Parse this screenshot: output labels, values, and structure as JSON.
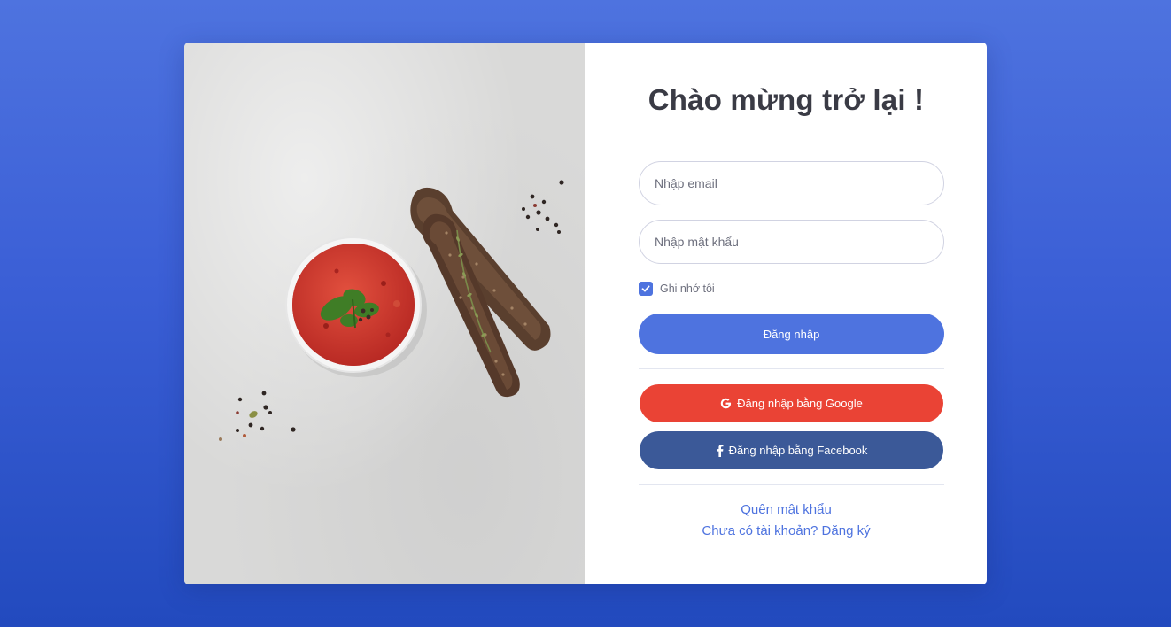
{
  "page": {
    "background_color": "#3b5fd6"
  },
  "image_panel": {
    "description_icon": "food-photo-tomato-soup-rye-bread"
  },
  "login_form": {
    "title": "Chào mừng trở lại !",
    "email_placeholder": "Nhập email",
    "password_placeholder": "Nhập mật khẩu",
    "remember_label": "Ghi nhớ tôi",
    "remember_checked": true,
    "login_button": "Đăng nhập",
    "google_button": "Đăng nhập bằng Google",
    "facebook_button": "Đăng nhập bằng Facebook",
    "forgot_password_link": "Quên mật khẩu",
    "register_link": "Chưa có tài khoản? Đăng ký"
  },
  "colors": {
    "primary": "#4e73df",
    "google": "#ea4335",
    "facebook": "#3b5998",
    "text": "#3a3b45",
    "muted": "#6e707e"
  },
  "icons": {
    "google": "google-icon",
    "facebook": "facebook-icon",
    "check": "check-icon"
  }
}
